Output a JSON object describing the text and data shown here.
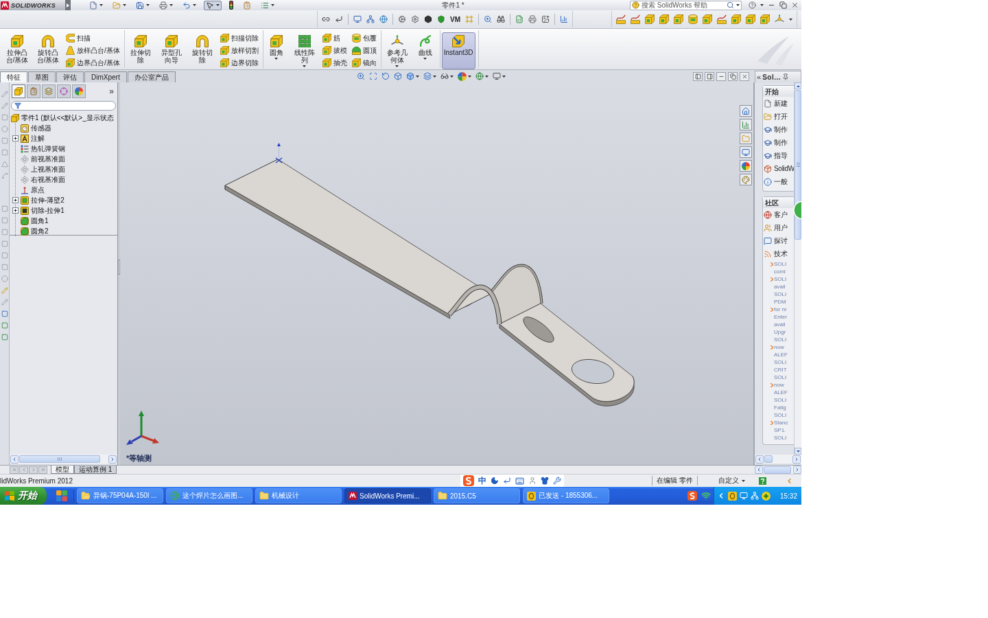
{
  "title_bar": {
    "logo": "SOLIDWORKS",
    "quick_access": [
      {
        "dropdown": true,
        "pressed": false
      },
      {
        "dropdown": true,
        "pressed": false
      },
      {
        "dropdown": true,
        "pressed": false
      },
      {
        "dropdown": true,
        "pressed": false
      },
      {
        "dropdown": true,
        "pressed": false
      },
      {
        "dropdown": true,
        "pressed": true
      },
      {
        "dropdown": false,
        "pressed": false
      },
      {
        "dropdown": false,
        "pressed": false
      },
      {
        "dropdown": true,
        "pressed": false
      }
    ],
    "document_title": "零件1 *",
    "search": {
      "placeholder": "搜索 SolidWorks 帮助"
    }
  },
  "view_toolbar": {
    "text_button": "VM"
  },
  "ribbon": {
    "groups": [
      {
        "items": [
          {
            "kind": "large",
            "label": "拉伸凸台/基体",
            "dropdown": false,
            "selected": false
          },
          {
            "kind": "large",
            "label": "旋转凸台/基体",
            "dropdown": false,
            "selected": false
          },
          {
            "kind": "small",
            "label": "扫描",
            "dropdown": false,
            "selected": false
          },
          {
            "kind": "small",
            "label": "放样凸台/基体",
            "dropdown": false,
            "selected": false
          },
          {
            "kind": "small",
            "label": "边界凸台/基体",
            "dropdown": false,
            "selected": false
          }
        ]
      },
      {
        "items": [
          {
            "kind": "large",
            "label": "拉伸切除",
            "dropdown": false,
            "selected": false
          },
          {
            "kind": "large",
            "label": "异型孔向导",
            "dropdown": false,
            "selected": false
          },
          {
            "kind": "large",
            "label": "旋转切除",
            "dropdown": false,
            "selected": false
          },
          {
            "kind": "small",
            "label": "扫描切除",
            "dropdown": false,
            "selected": false
          },
          {
            "kind": "small",
            "label": "放样切割",
            "dropdown": false,
            "selected": false
          },
          {
            "kind": "small",
            "label": "边界切除",
            "dropdown": false,
            "selected": false
          }
        ]
      },
      {
        "items": [
          {
            "kind": "large",
            "label": "圆角",
            "dropdown": true,
            "selected": false
          },
          {
            "kind": "large",
            "label": "线性阵列",
            "dropdown": true,
            "selected": false
          },
          {
            "kind": "small",
            "label": "筋",
            "dropdown": false,
            "selected": false
          },
          {
            "kind": "small",
            "label": "拔模",
            "dropdown": false,
            "selected": false
          },
          {
            "kind": "small",
            "label": "抽壳",
            "dropdown": false,
            "selected": false
          },
          {
            "kind": "small",
            "label": "包覆",
            "dropdown": false,
            "selected": false
          },
          {
            "kind": "small",
            "label": "圆顶",
            "dropdown": false,
            "selected": false
          },
          {
            "kind": "small",
            "label": "镜向",
            "dropdown": false,
            "selected": false
          }
        ]
      },
      {
        "items": [
          {
            "kind": "large",
            "label": "参考几何体",
            "dropdown": true,
            "selected": false
          },
          {
            "kind": "large",
            "label": "曲线",
            "dropdown": true,
            "selected": false
          }
        ]
      },
      {
        "items": [
          {
            "kind": "large",
            "label": "Instant3D",
            "dropdown": false,
            "selected": true
          }
        ]
      }
    ]
  },
  "tabs": [
    {
      "label": "特征",
      "selected": true
    },
    {
      "label": "草图",
      "selected": false
    },
    {
      "label": "评估",
      "selected": false
    },
    {
      "label": "DimXpert",
      "selected": false
    },
    {
      "label": "办公室产品",
      "selected": false
    }
  ],
  "feature_manager": {
    "tabs": [
      {
        "selected": true
      },
      {
        "selected": false
      },
      {
        "selected": false
      },
      {
        "selected": false
      },
      {
        "selected": false
      }
    ],
    "more": "»",
    "tree": {
      "kind": "part",
      "label": "零件1 (默认<<默认>_显示状态",
      "children": [
        {
          "kind": "sensors",
          "label": "传感器",
          "expandable": false
        },
        {
          "kind": "annotations",
          "label": "注解",
          "expandable": true
        },
        {
          "kind": "material",
          "label": "热轧弹簧钢",
          "expandable": false
        },
        {
          "kind": "plane",
          "label": "前视基准面",
          "expandable": false
        },
        {
          "kind": "plane",
          "label": "上视基准面",
          "expandable": false
        },
        {
          "kind": "plane",
          "label": "右视基准面",
          "expandable": false
        },
        {
          "kind": "origin",
          "label": "原点",
          "expandable": false
        },
        {
          "kind": "extrude",
          "label": "拉伸-薄壁2",
          "expandable": true
        },
        {
          "kind": "cut",
          "label": "切除-拉伸1",
          "expandable": true
        },
        {
          "kind": "fillet",
          "label": "圆角1",
          "expandable": false
        },
        {
          "kind": "fillet",
          "label": "圆角2",
          "expandable": false
        }
      ]
    },
    "bottom_tabs": [
      {
        "label": "模型",
        "selected": true
      },
      {
        "label": "运动算例 1",
        "selected": false
      }
    ]
  },
  "viewport": {
    "view_name": "*等轴测"
  },
  "task_pane": {
    "collapse": "«",
    "title": "Sol...",
    "sections": [
      {
        "heading": "开始",
        "items": [
          "新建",
          "打开",
          "制作",
          "制作",
          "指导",
          "SolidW",
          "一般"
        ]
      },
      {
        "heading": "社区",
        "items": [
          "客户",
          "用户",
          "探讨",
          "技术"
        ]
      }
    ],
    "news": [
      {
        "lines": [
          "SOLI",
          "comi"
        ]
      },
      {
        "lines": [
          "SOLI",
          "avail",
          "SOLI",
          "PDM"
        ]
      },
      {
        "lines": [
          "for nr",
          "Enter",
          "avail",
          "Upgr",
          "SOLI"
        ]
      },
      {
        "lines": [
          "now",
          "ALEF",
          "SOLI",
          "CRIT",
          "SOLI"
        ]
      },
      {
        "lines": [
          "now",
          "ALEF",
          "SOLI",
          "Fatig",
          "SOLI"
        ]
      },
      {
        "lines": [
          "Stanc",
          "SP1.",
          "SOLI"
        ]
      }
    ]
  },
  "status_bar": {
    "product": "lidWorks Premium 2012",
    "ime_mode": "中",
    "editing": "在编辑 零件",
    "units": "自定义"
  },
  "taskbar": {
    "start": "开始",
    "tasks": [
      {
        "label": "异锅-75P04A-150l ...",
        "selected": false
      },
      {
        "label": "这个焊片怎么画图...",
        "selected": false
      },
      {
        "label": "机械设计",
        "selected": false
      },
      {
        "label": "SolidWorks Premi...",
        "selected": true
      },
      {
        "label": "2015.C5",
        "selected": false
      },
      {
        "label": "已发送 - 1855306...",
        "selected": false
      }
    ],
    "clock": "15:32"
  }
}
